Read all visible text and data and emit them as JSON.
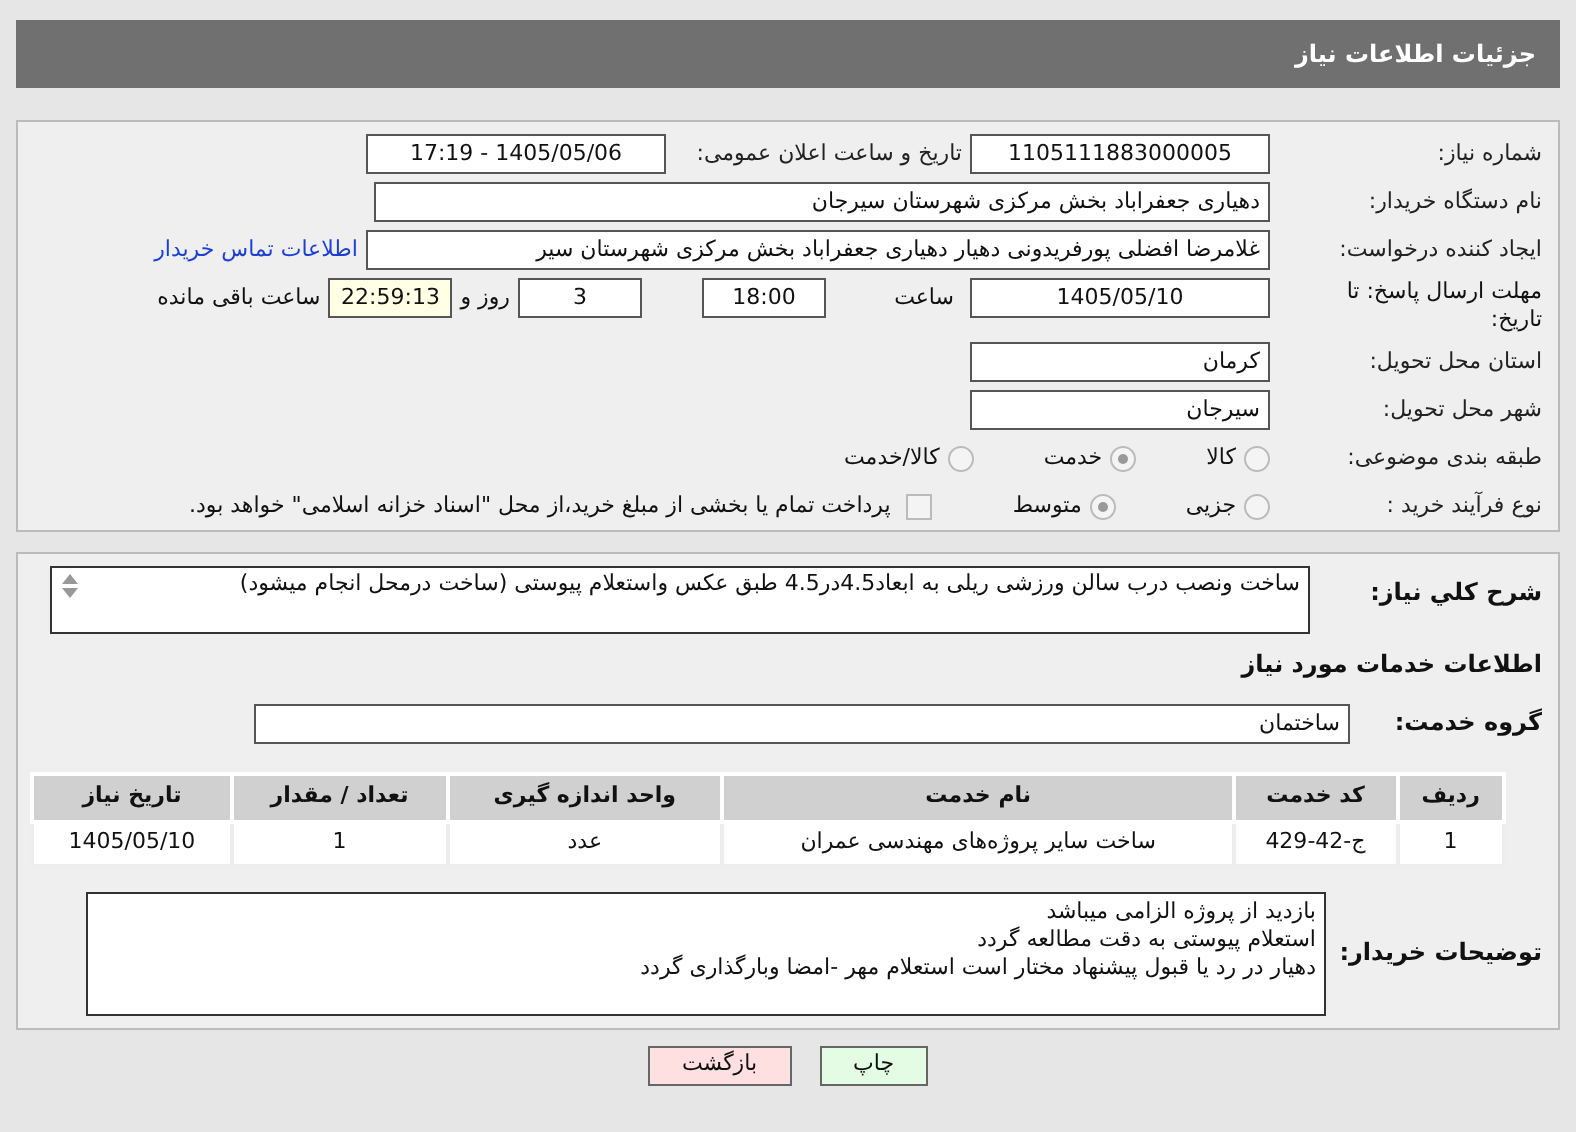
{
  "header": {
    "title": "جزئیات اطلاعات نیاز"
  },
  "need_number": {
    "label": "شماره نیاز:",
    "value": "1105111883000005"
  },
  "announce_date": {
    "label": "تاریخ و ساعت اعلان عمومی:",
    "value": "1405/05/06 - 17:19"
  },
  "buyer": {
    "label": "نام دستگاه خریدار:",
    "value": "دهیاری جعفراباد بخش مرکزی شهرستان سیرجان"
  },
  "requester": {
    "label": "ایجاد کننده درخواست:",
    "value": "غلامرضا افضلی پورفریدونی دهیار دهیاری جعفراباد بخش مرکزی شهرستان سیر",
    "link": "اطلاعات تماس خریدار"
  },
  "deadline": {
    "label": "مهلت ارسال پاسخ: تا تاریخ:",
    "date": "1405/05/10",
    "time_label": "ساعت",
    "time": "18:00",
    "days": "3",
    "days_label": "روز و",
    "remaining": "22:59:13",
    "remaining_label": "ساعت باقی مانده"
  },
  "province": {
    "label": "استان محل تحویل:",
    "value": "کرمان"
  },
  "city": {
    "label": "شهر محل تحویل:",
    "value": "سیرجان"
  },
  "category": {
    "label": "طبقه بندی موضوعی:",
    "options": [
      {
        "label": "کالا",
        "selected": false
      },
      {
        "label": "خدمت",
        "selected": true
      },
      {
        "label": "کالا/خدمت",
        "selected": false
      }
    ]
  },
  "process": {
    "label": "نوع فرآیند خرید :",
    "options": [
      {
        "label": "جزیی",
        "selected": false
      },
      {
        "label": "متوسط",
        "selected": true
      }
    ],
    "payment": {
      "checked": false,
      "text": "پرداخت تمام یا بخشی از مبلغ خرید،از محل \"اسناد خزانه اسلامی\" خواهد بود."
    }
  },
  "summary": {
    "label": "شرح کلي نياز:",
    "value": "ساخت ونصب درب سالن ورزشی ریلی به ابعاد4.5در4.5 طبق عکس واستعلام پیوستی (ساخت درمحل انجام میشود)"
  },
  "services_title": "اطلاعات خدمات مورد نیاز",
  "service_group": {
    "label": "گروه خدمت:",
    "value": "ساختمان"
  },
  "table": {
    "columns": [
      "ردیف",
      "کد خدمت",
      "نام خدمت",
      "واحد اندازه گیری",
      "تعداد / مقدار",
      "تاریخ نیاز"
    ],
    "rows": [
      [
        "1",
        "ج-42-429",
        "ساخت سایر پروژه‌های مهندسی عمران",
        "عدد",
        "1",
        "1405/05/10"
      ]
    ]
  },
  "notes": {
    "label": "توضیحات خریدار:",
    "lines": [
      "بازدید از پروژه الزامی میباشد",
      "استعلام پیوستی به دقت مطالعه گردد",
      "دهیار در رد یا قبول پیشنهاد مختار است استعلام مهر -امضا وبارگذاری گردد"
    ]
  },
  "buttons": [
    {
      "label": "چاپ",
      "kind": "print"
    },
    {
      "label": "بازگشت",
      "kind": "back"
    }
  ]
}
